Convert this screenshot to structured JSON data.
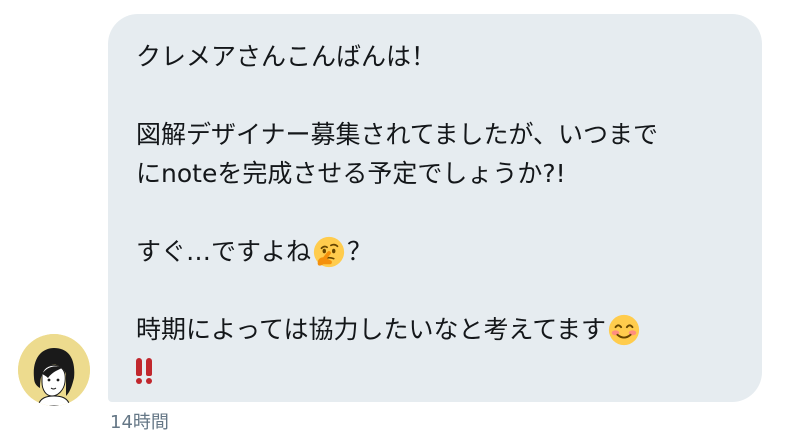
{
  "message": {
    "line1": "クレメアさんこんばんは！",
    "line2": "図解デザイナー募集されてましたが、いつまで",
    "line3": "にnoteを完成させる予定でしょうか?!",
    "line4_text": "すぐ…ですよね",
    "line4_emoji": "thinking-face-emoji",
    "line4_tail": "？",
    "line5_text": "時期によっては協力したいなと考えてます",
    "line5_emoji": "smiling-face-emoji",
    "line6_emoji": "double-exclamation-emoji"
  },
  "timestamp": "14時間",
  "colors": {
    "bubble_bg": "#e6ecf0",
    "text": "#14171a",
    "timestamp": "#657786",
    "avatar_bg": "#eddb8e",
    "exclamation": "#c1272d"
  },
  "avatar": {
    "icon": "user-avatar-illustration"
  }
}
